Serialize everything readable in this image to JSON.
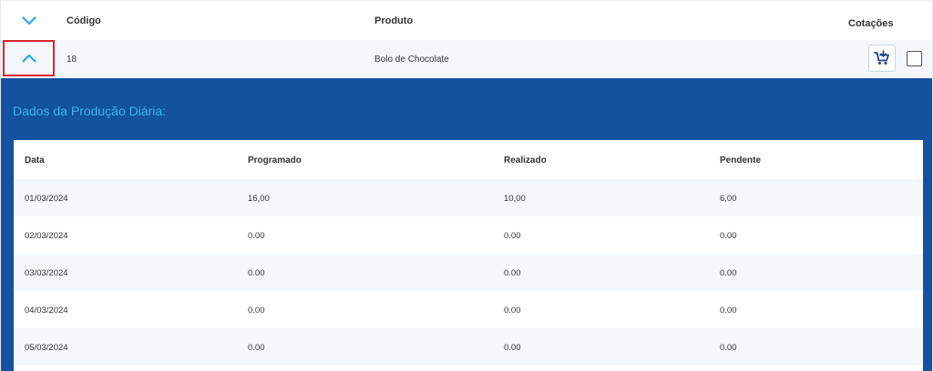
{
  "header": {
    "codigo_label": "Código",
    "produto_label": "Produto",
    "cotacoes_label": "Cotações"
  },
  "product": {
    "codigo": "18",
    "produto": "Bolo de Chocolate"
  },
  "detail": {
    "title": "Dados da Produção Diária:",
    "columns": [
      "Data",
      "Programado",
      "Realizado",
      "Pendente"
    ],
    "rows": [
      [
        "01/03/2024",
        "16,00",
        "10,00",
        "6,00"
      ],
      [
        "02/03/2024",
        "0.00",
        "0.00",
        "0.00"
      ],
      [
        "03/03/2024",
        "0.00",
        "0.00",
        "0.00"
      ],
      [
        "04/03/2024",
        "0.00",
        "0.00",
        "0.00"
      ],
      [
        "05/03/2024",
        "0.00",
        "0.00",
        "0.00"
      ]
    ]
  },
  "icons": {
    "expand_all": "chevron-down-icon",
    "collapse_row": "chevron-up-icon",
    "cart": "add-to-cart-icon"
  },
  "colors": {
    "panel_background": "#13529d",
    "panel_title": "#3fb3f0",
    "chevron": "#29a8e8",
    "highlight_border": "#d9262c",
    "row_alt": "#f4f7fb"
  }
}
